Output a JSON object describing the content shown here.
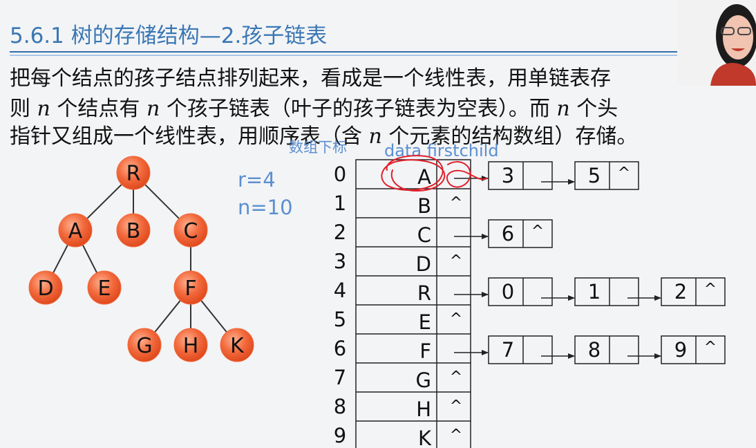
{
  "slide": {
    "title": "5.6.1 树的存储结构—2.孩子链表",
    "para": {
      "line1": "把每个结点的孩子结点排列起来，看成是一个线性表，用单链表存",
      "line2": [
        "则 ",
        "n",
        " 个结点有 ",
        "n",
        " 个孩子链表（叶子的孩子链表为空表）。而 ",
        "n",
        " 个头"
      ],
      "line3": [
        "指针又组成一个线性表，用顺序表（含 ",
        "n",
        " 个元素的结构数组）存储。"
      ]
    },
    "stats": {
      "r": "r=4",
      "n": "n=10"
    },
    "table_header": {
      "index": "数组下标",
      "fields": "data firstchild"
    },
    "null_symbol": "^"
  },
  "tree": {
    "node_color": "#f26a3d",
    "nodes": [
      "R",
      "A",
      "B",
      "C",
      "D",
      "E",
      "F",
      "G",
      "H",
      "K"
    ],
    "edges": [
      [
        "R",
        "A"
      ],
      [
        "R",
        "B"
      ],
      [
        "R",
        "C"
      ],
      [
        "A",
        "D"
      ],
      [
        "A",
        "E"
      ],
      [
        "C",
        "F"
      ],
      [
        "F",
        "G"
      ],
      [
        "F",
        "H"
      ],
      [
        "F",
        "K"
      ]
    ]
  },
  "array": [
    {
      "index": "0",
      "data": "A",
      "children": [
        "3",
        "5"
      ]
    },
    {
      "index": "1",
      "data": "B",
      "children": []
    },
    {
      "index": "2",
      "data": "C",
      "children": [
        "6"
      ]
    },
    {
      "index": "3",
      "data": "D",
      "children": []
    },
    {
      "index": "4",
      "data": "R",
      "children": [
        "0",
        "1",
        "2"
      ]
    },
    {
      "index": "5",
      "data": "E",
      "children": []
    },
    {
      "index": "6",
      "data": "F",
      "children": [
        "7",
        "8",
        "9"
      ]
    },
    {
      "index": "7",
      "data": "G",
      "children": []
    },
    {
      "index": "8",
      "data": "H",
      "children": []
    },
    {
      "index": "9",
      "data": "K",
      "children": []
    }
  ],
  "colors": {
    "title": "#3a77b4",
    "stats": "#5b8fd0",
    "header": "#5b8fd0",
    "annotation": "#e0202a"
  }
}
